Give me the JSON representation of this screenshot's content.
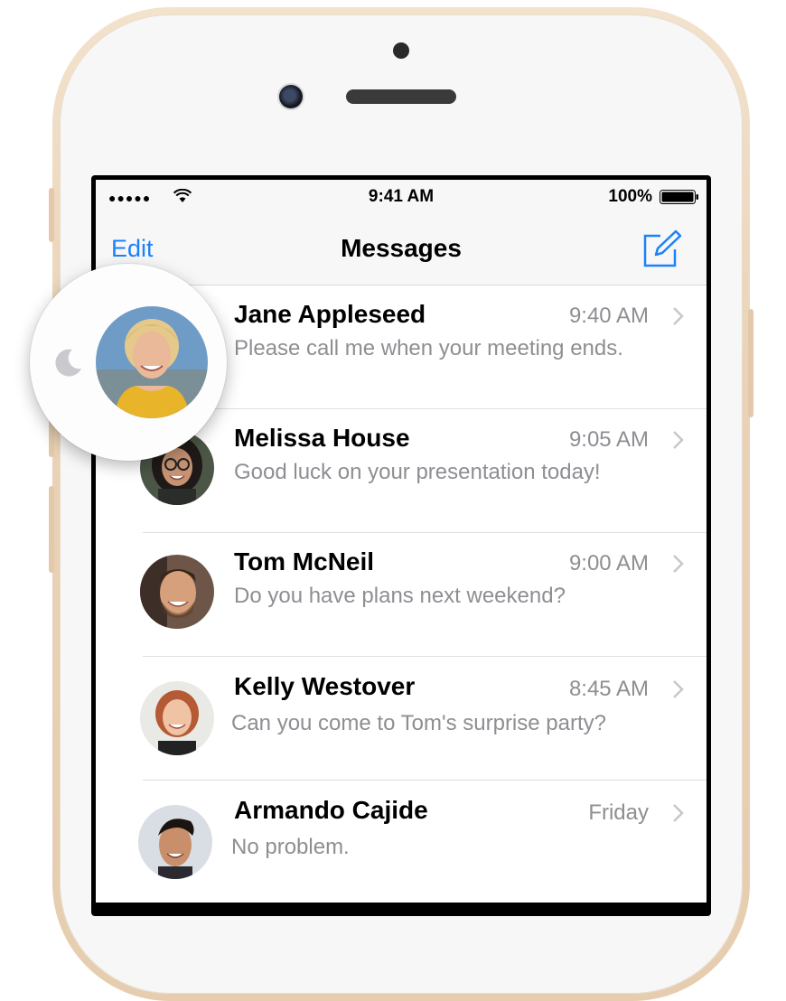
{
  "status_bar": {
    "signal_dots": "●●●●●",
    "wifi_icon": "wifi-icon",
    "time": "9:41 AM",
    "battery_percent": "100%",
    "battery_icon": "battery-full-icon"
  },
  "nav": {
    "edit_label": "Edit",
    "title": "Messages",
    "compose_icon": "compose-icon"
  },
  "conversations": [
    {
      "name": "Jane Appleseed",
      "time": "9:40 AM",
      "preview": "Please call me when your meeting ends.",
      "dnd": true
    },
    {
      "name": "Melissa House",
      "time": "9:05 AM",
      "preview": "Good luck on your presentation today!"
    },
    {
      "name": "Tom McNeil",
      "time": "9:00 AM",
      "preview": "Do you have plans next weekend?"
    },
    {
      "name": "Kelly Westover",
      "time": "8:45 AM",
      "preview": "Can you come to Tom's surprise party?"
    },
    {
      "name": "Armando Cajide",
      "time": "Friday",
      "preview": "No problem."
    }
  ],
  "colors": {
    "accent": "#1a82fb",
    "secondary_text": "#8e8e93",
    "phone_gold": "#e9d2b6"
  }
}
